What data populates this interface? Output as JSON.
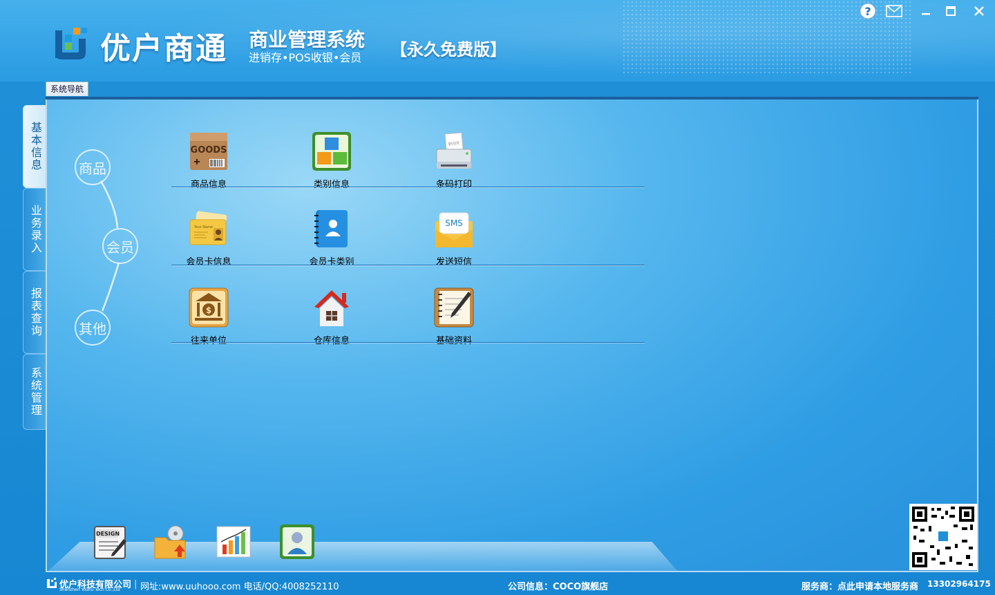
{
  "header": {
    "brand": "优户商通",
    "system_title": "商业管理系统",
    "subtitle": "进销存•POS收银•会员",
    "edition": "【永久免费版】"
  },
  "window_controls": {
    "help": "?",
    "mail": "✉",
    "minimize": "—",
    "maximize": "□",
    "close": "✕"
  },
  "nav_tab": "系统导航",
  "side_tabs": [
    {
      "label": "基本信息",
      "active": true
    },
    {
      "label": "业务录入",
      "active": false
    },
    {
      "label": "报表查询",
      "active": false
    },
    {
      "label": "系统管理",
      "active": false
    }
  ],
  "categories": [
    "商品",
    "会员",
    "其他"
  ],
  "items": {
    "goods": {
      "label": "商品信息",
      "icon_text": "GOODS"
    },
    "category": {
      "label": "类别信息"
    },
    "barcode": {
      "label": "条码打印",
      "icon_text": "Print"
    },
    "member_card": {
      "label": "会员卡信息",
      "icon_text": "Your Name"
    },
    "member_type": {
      "label": "会员卡类别"
    },
    "sms": {
      "label": "发送短信",
      "icon_text": "SMS"
    },
    "partner": {
      "label": "往来单位"
    },
    "warehouse": {
      "label": "仓库信息"
    },
    "basic": {
      "label": "基础资料"
    }
  },
  "shelf_icons": {
    "design_text": "DESIGN"
  },
  "footer": {
    "company": "优户科技有限公司",
    "company_en": "Shenzhen Youhu Tech Co.,Ltd",
    "website": "网址:www.uuhooo.com 电话/QQ:4008252110",
    "company_info": "公司信息：COCO旗舰店",
    "service": "服务商：点此申请本地服务商",
    "phone": "13302964175"
  },
  "colors": {
    "accent": "#1787d3",
    "panel": "#56b7ee"
  }
}
